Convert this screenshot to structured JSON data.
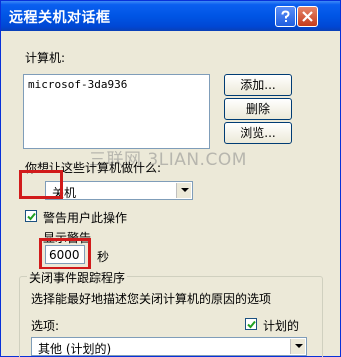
{
  "window": {
    "title": "远程关机对话框",
    "buttons": {
      "help_icon": "help-icon",
      "close_icon": "close-icon"
    }
  },
  "computers": {
    "label": "计算机:",
    "items": [
      "microsof-3da936"
    ]
  },
  "actions": {
    "add_label": "添加...",
    "remove_label": "删除",
    "browse_label": "浏览..."
  },
  "watermark": "三联网 3LIAN.COM",
  "operation": {
    "prompt": "你想让这些计算机做什么:",
    "selected": "关机"
  },
  "warn": {
    "checkbox_label": "警告用户此操作",
    "checked": true,
    "display_label": "显示警告",
    "seconds_value": "6000",
    "seconds_unit": "秒"
  },
  "tracker": {
    "group_title": "关闭事件跟踪程序",
    "description": "选择能最好地描述您关闭计算机的原因的选项",
    "options_label": "选项:",
    "planned_label": "计划的",
    "planned_checked": true,
    "selected_option": "其他 (计划的)"
  },
  "colors": {
    "titlebar": "#0055e5",
    "dialog_bg": "#ece9d8",
    "highlight_box": "#d11b1b"
  }
}
